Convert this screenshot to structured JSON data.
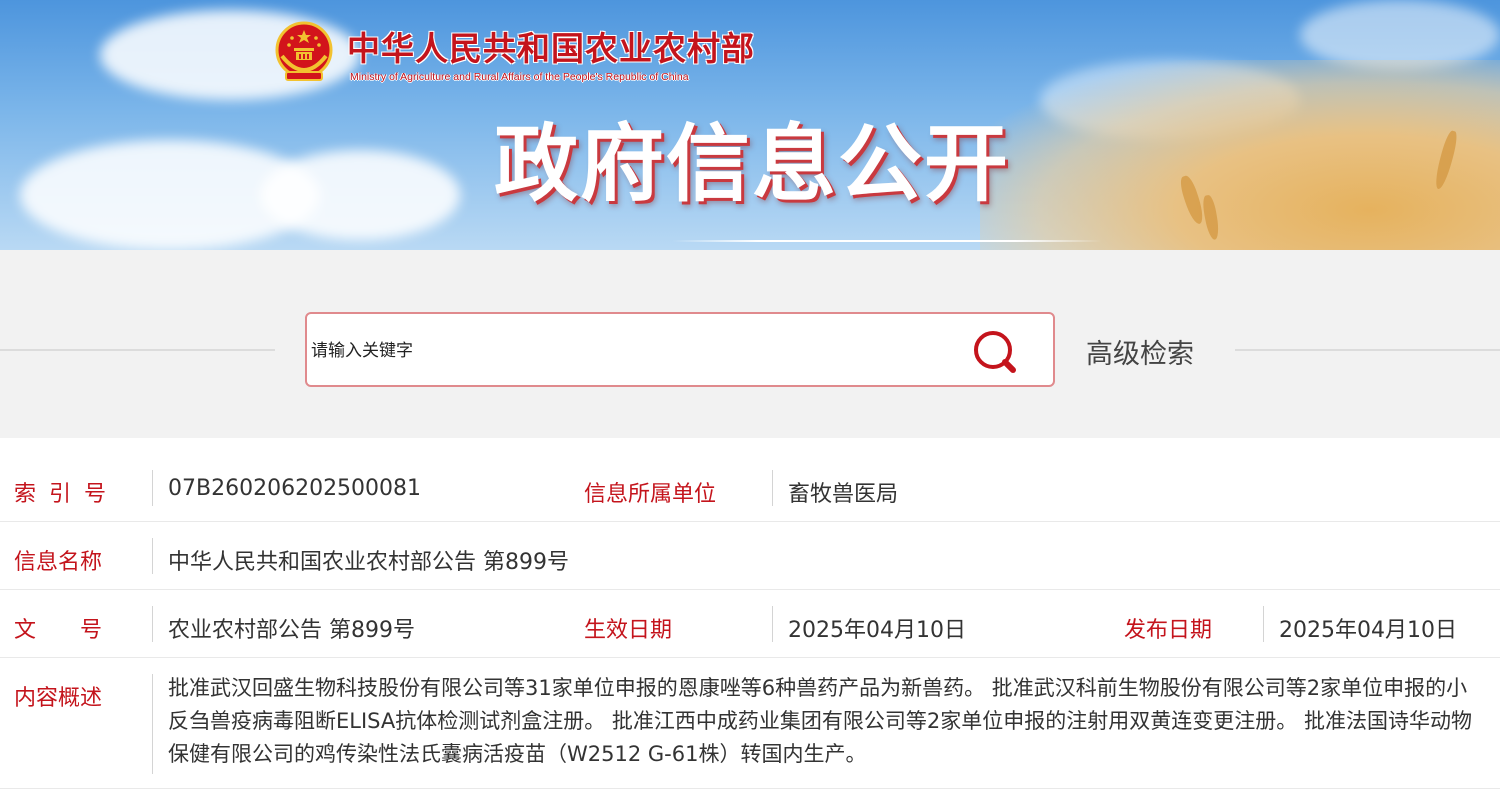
{
  "header": {
    "ministry_cn": "中华人民共和国农业农村部",
    "ministry_en": "Ministry of Agriculture and Rural Affairs of the People's Republic of China",
    "banner_title": "政府信息公开",
    "emblem_icon": "national-emblem-icon"
  },
  "search": {
    "placeholder": "请输入关键字",
    "value": "",
    "search_icon": "search-icon",
    "advanced_label": "高级检索"
  },
  "info": {
    "index_label": "索 引 号",
    "index_value": "07B260206202500081",
    "unit_label": "信息所属单位",
    "unit_value": "畜牧兽医局",
    "name_label": "信息名称",
    "name_value": "中华人民共和国农业农村部公告 第899号",
    "docno_label": "文　　号",
    "docno_value": "农业农村部公告 第899号",
    "effective_label": "生效日期",
    "effective_value": "2025年04月10日",
    "publish_label": "发布日期",
    "publish_value": "2025年04月10日",
    "summary_label": "内容概述",
    "summary_value": "批准武汉回盛生物科技股份有限公司等31家单位申报的恩康唑等6种兽药产品为新兽药。 批准武汉科前生物股份有限公司等2家单位申报的小反刍兽疫病毒阻断ELISA抗体检测试剂盒注册。 批准江西中成药业集团有限公司等2家单位申报的注射用双黄连变更注册。 批准法国诗华动物保健有限公司的鸡传染性法氏囊病活疫苗（W2512 G-61株）转国内生产。"
  },
  "colors": {
    "accent_red": "#c4141c",
    "search_border": "#e08a8d",
    "search_band_bg": "#f2f2f2"
  }
}
